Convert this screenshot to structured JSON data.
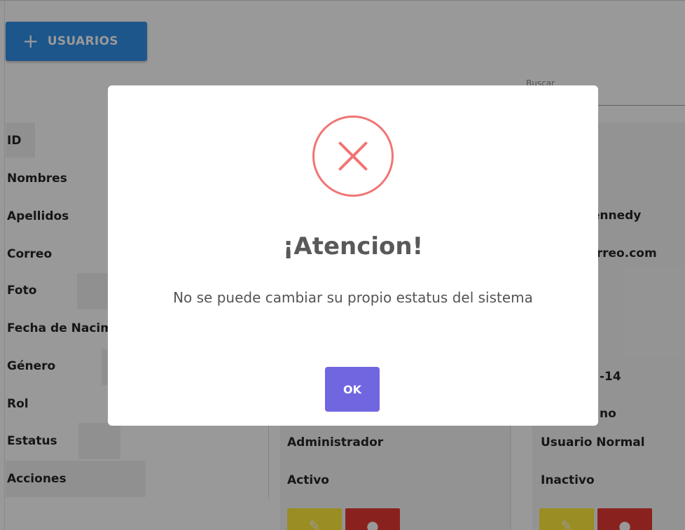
{
  "toolbar": {
    "add_users_label": "USUARIOS"
  },
  "search": {
    "label": "Buscar"
  },
  "table": {
    "row_headers": [
      "ID",
      "Nombres",
      "Apellidos",
      "Correo",
      "Foto",
      "Fecha de Nacimiento",
      "Género",
      "Rol",
      "Estatus",
      "Acciones"
    ],
    "users": [
      {
        "rol": "Administrador",
        "estatus": "Activo"
      },
      {
        "apellidos": "Kennedy",
        "correo": "correo.com",
        "fecha": "-14",
        "genero": "no",
        "rol": "Usuario Normal",
        "estatus": "Inactivo"
      }
    ]
  },
  "modal": {
    "icon": "error-x-icon",
    "title": "¡Atencion!",
    "message": "No se puede cambiar su propio estatus del sistema",
    "ok_label": "OK",
    "colors": {
      "icon": "#f27474",
      "button": "#7066e0"
    }
  },
  "colors": {
    "primary": "#2f8fe8",
    "edit": "#ffeb3b",
    "delete": "#e53935"
  }
}
